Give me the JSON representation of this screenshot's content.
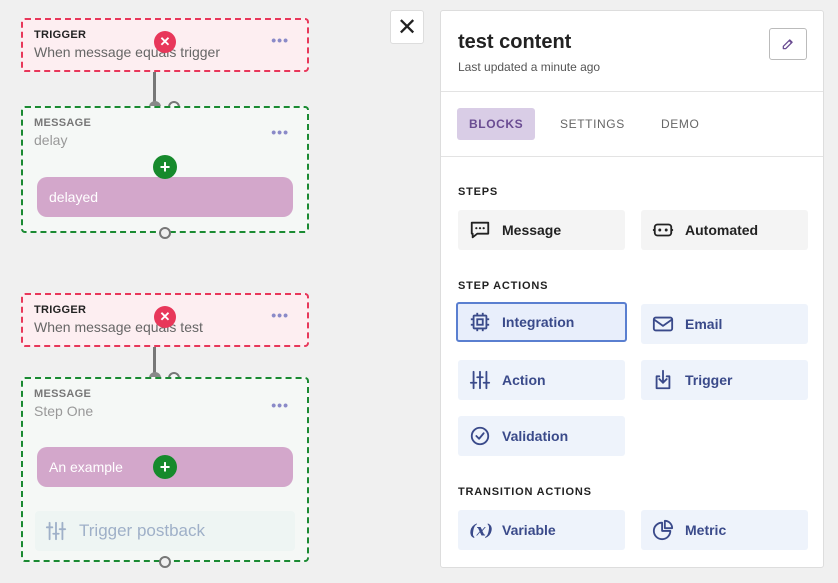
{
  "canvas": {
    "flows": [
      {
        "trigger": {
          "kind": "TRIGGER",
          "text": "When message equals trigger",
          "menu": "•••"
        },
        "message": {
          "kind": "MESSAGE",
          "text": "delay",
          "menu": "•••",
          "blocks": [
            "delayed"
          ]
        }
      },
      {
        "trigger": {
          "kind": "TRIGGER",
          "text": "When message equals test",
          "menu": "•••"
        },
        "message": {
          "kind": "MESSAGE",
          "text": "Step One",
          "menu": "•••",
          "blocks": [
            "An example"
          ],
          "postback": "Trigger postback"
        }
      }
    ],
    "delete_glyph": "✕",
    "add_glyph": "+"
  },
  "close_glyph": "✕",
  "panel": {
    "title": "test content",
    "subtitle": "Last updated a minute ago",
    "tabs": [
      "BLOCKS",
      "SETTINGS",
      "DEMO"
    ],
    "active_tab": "BLOCKS",
    "sections": [
      {
        "label": "STEPS",
        "items": [
          {
            "label": "Message",
            "icon": "message-icon"
          },
          {
            "label": "Automated",
            "icon": "robot-icon"
          }
        ]
      },
      {
        "label": "STEP ACTIONS",
        "items": [
          {
            "label": "Integration",
            "icon": "chip-icon",
            "selected": true
          },
          {
            "label": "Email",
            "icon": "email-icon"
          },
          {
            "label": "Action",
            "icon": "sliders-icon"
          },
          {
            "label": "Trigger",
            "icon": "download-icon"
          },
          {
            "label": "Validation",
            "icon": "check-circle-icon"
          }
        ]
      },
      {
        "label": "TRANSITION ACTIONS",
        "items": [
          {
            "label": "Variable",
            "icon": "variable-icon"
          },
          {
            "label": "Metric",
            "icon": "pie-chart-icon"
          }
        ]
      }
    ]
  },
  "colors": {
    "trigger_border": "#e8375a",
    "message_border": "#1a8a32",
    "block_fill": "#d3a7cb",
    "tab_active": "#d9cde6",
    "accent_blue": "#3a4a8a"
  }
}
